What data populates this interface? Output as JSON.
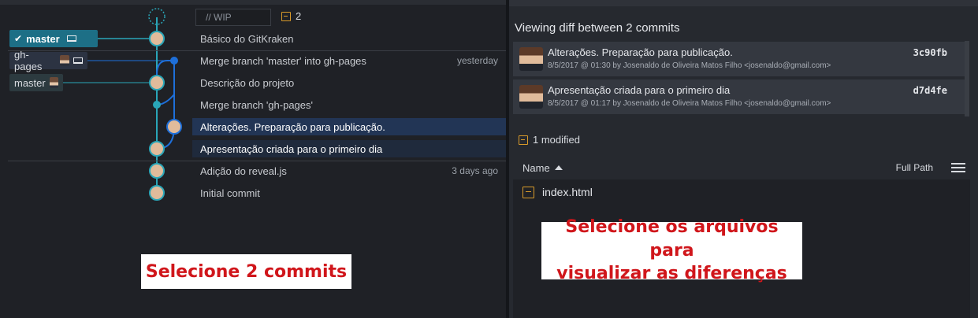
{
  "graph": {
    "wip_placeholder": "// WIP",
    "wip_count": "2",
    "branches": {
      "master_local": "master",
      "gh_pages": "gh-pages",
      "master_remote": "master"
    },
    "commits": [
      {
        "message": "Básico do GitKraken",
        "date": ""
      },
      {
        "message": "Merge branch 'master' into gh-pages",
        "date": "yesterday"
      },
      {
        "message": "Descrição do projeto",
        "date": ""
      },
      {
        "message": "Merge branch 'gh-pages'",
        "date": ""
      },
      {
        "message": "Alterações. Preparação para publicação.",
        "date": ""
      },
      {
        "message": "Apresentação criada para o primeiro dia",
        "date": ""
      },
      {
        "message": "Adição do reveal.js",
        "date": "3 days ago"
      },
      {
        "message": "Initial commit",
        "date": ""
      }
    ],
    "annotation": "Selecione 2 commits"
  },
  "diff": {
    "title": "Viewing diff between 2 commits",
    "commits": [
      {
        "subject": "Alterações. Preparação para publicação.",
        "meta": "8/5/2017 @ 01:30 by Josenaldo de Oliveira Matos Filho <josenaldo@gmail.com>",
        "sha": "3c90fb"
      },
      {
        "subject": "Apresentação criada para o primeiro dia",
        "meta": "8/5/2017 @ 01:17 by Josenaldo de Oliveira Matos Filho <josenaldo@gmail.com>",
        "sha": "d7d4fe"
      }
    ],
    "modified_label": "1 modified",
    "name_header": "Name",
    "full_path_label": "Full Path",
    "files": [
      "index.html"
    ],
    "annotation_line1": "Selecione os arquivos para",
    "annotation_line2": "visualizar as diferenças"
  },
  "colors": {
    "accent_branch": "#1d6f86",
    "graph_line_teal": "#2aa6b8",
    "graph_line_blue": "#1e6fd9",
    "annotation_red": "#d0161b",
    "file_modified": "#d89a2a"
  },
  "icons": [
    "check-icon",
    "laptop-icon",
    "file-modified-icon",
    "sort-ascending-icon",
    "list-view-icon"
  ]
}
